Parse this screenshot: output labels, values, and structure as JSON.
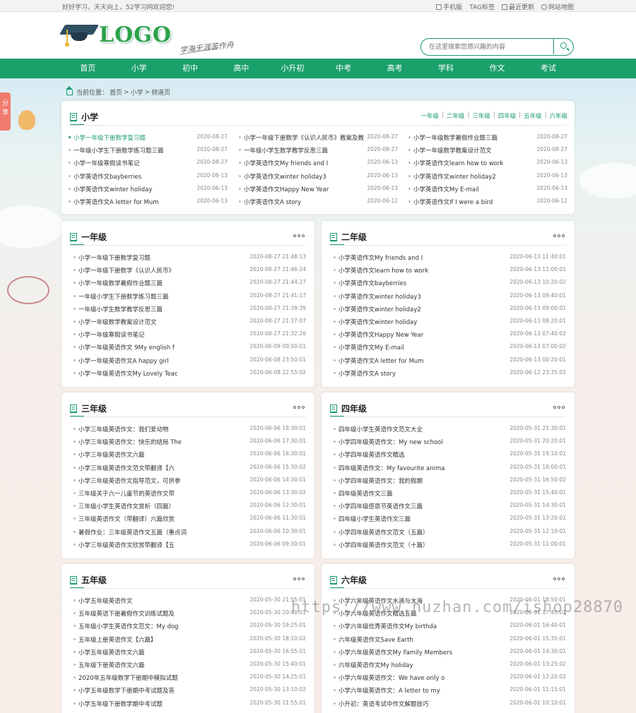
{
  "topbar": {
    "welcome": "好好学习，天天向上，52学习网欢迎您!",
    "links": [
      "手机版",
      "TAG标签",
      "最近更新",
      "网站地图"
    ]
  },
  "header": {
    "logo_text": "LOGO",
    "slogan": "学海无涯苦作舟",
    "search_placeholder": "在这里搜索您感兴趣的内容"
  },
  "nav": [
    "首页",
    "小学",
    "初中",
    "高中",
    "小升初",
    "中考",
    "高考",
    "学科",
    "作文",
    "考试"
  ],
  "breadcrumb": {
    "label": "当前位置：",
    "items": [
      "首页",
      ">",
      "小学",
      ">",
      "频道页"
    ]
  },
  "share": "分享",
  "top_panel": {
    "title": "小学",
    "grades": [
      "一年级",
      "二年级",
      "三年级",
      "四年级",
      "五年级",
      "六年级"
    ],
    "columns": [
      [
        {
          "t": "小学一年级下册数学复习题",
          "d": "2020-08-27"
        },
        {
          "t": "一年级小学生下册数学练习题三篇",
          "d": "2020-08-27"
        },
        {
          "t": "小学一年级寒假读书笔记",
          "d": "2020-08-27"
        },
        {
          "t": "小学英语作文bayberries",
          "d": "2020-06-13"
        },
        {
          "t": "小学英语作文winter holiday",
          "d": "2020-06-13"
        },
        {
          "t": "小学英语作文A letter for Mum",
          "d": "2020-06-13"
        }
      ],
      [
        {
          "t": "小学一年级下册数学《认识人民币》教案及教",
          "d": "2020-08-27"
        },
        {
          "t": "一年级小学生数学教学反思三篇",
          "d": "2020-08-27"
        },
        {
          "t": "小学英语作文My friends and I",
          "d": "2020-06-13"
        },
        {
          "t": "小学英语作文winter holiday3",
          "d": "2020-06-13"
        },
        {
          "t": "小学英语作文Happy New Year",
          "d": "2020-06-13"
        },
        {
          "t": "小学英语作文A story",
          "d": "2020-06-12"
        }
      ],
      [
        {
          "t": "小学一年级数学暑假作业题三篇",
          "d": "2020-08-27"
        },
        {
          "t": "小学一年级数学教案设计范文",
          "d": "2020-08-27"
        },
        {
          "t": "小学英语作文learn how to work",
          "d": "2020-06-13"
        },
        {
          "t": "小学英语作文winter holiday2",
          "d": "2020-06-13"
        },
        {
          "t": "小学英语作文My E-mail",
          "d": "2020-06-13"
        },
        {
          "t": "小学英语作文If I were a bird",
          "d": "2020-06-12"
        }
      ]
    ]
  },
  "panels": [
    {
      "title": "一年级",
      "items": [
        {
          "t": "小学一年级下册数学复习题",
          "d": "2020-08-27 21:48:13"
        },
        {
          "t": "小学一年级下册数学《认识人民币》",
          "d": "2020-08-27 21:46:24"
        },
        {
          "t": "小学一年级数学暑假作业题三篇",
          "d": "2020-08-27 21:44:27"
        },
        {
          "t": "一年级小学生下册数学练习题三篇",
          "d": "2020-08-27 21:41:17"
        },
        {
          "t": "一年级小学生数学教学反思三篇",
          "d": "2020-08-27 21:39:39"
        },
        {
          "t": "小学一年级数学教案设计范文",
          "d": "2020-08-27 21:37:07"
        },
        {
          "t": "小学一年级寒假读书笔记",
          "d": "2020-08-27 21:32:26"
        },
        {
          "t": "小学一年级英语作文 9My english f",
          "d": "2020-06-09 00:50:01"
        },
        {
          "t": "小学一年级英语作文A happy girl",
          "d": "2020-06-08 23:50:01"
        },
        {
          "t": "小学一年级英语作文My Lovely Teac",
          "d": "2020-06-08 22:55:02"
        }
      ]
    },
    {
      "title": "二年级",
      "items": [
        {
          "t": "小学英语作文My friends and I",
          "d": "2020-06-13 11:40:01"
        },
        {
          "t": "小学英语作文learn how to work",
          "d": "2020-06-13 11:00:01"
        },
        {
          "t": "小学英语作文bayberries",
          "d": "2020-06-13 10:20:02"
        },
        {
          "t": "小学英语作文winter holiday3",
          "d": "2020-06-13 09:40:01"
        },
        {
          "t": "小学英语作文winter holiday2",
          "d": "2020-06-13 09:00:01"
        },
        {
          "t": "小学英语作文winter holiday",
          "d": "2020-06-13 08:20:01"
        },
        {
          "t": "小学英语作文Happy New Year",
          "d": "2020-06-13 07:40:02"
        },
        {
          "t": "小学英语作文My E-mail",
          "d": "2020-06-13 07:00:02"
        },
        {
          "t": "小学英语作文A letter for Mum",
          "d": "2020-06-13 00:20:01"
        },
        {
          "t": "小学英语作文A story",
          "d": "2020-06-12 23:35:02"
        }
      ]
    },
    {
      "title": "三年级",
      "items": [
        {
          "t": "小学三年级英语作文：我们爱动物",
          "d": "2020-06-06 18:30:01"
        },
        {
          "t": "小学三年级英语作文：快乐的结局 The",
          "d": "2020-06-06 17:30:01"
        },
        {
          "t": "小学三年级英语作文六篇",
          "d": "2020-06-06 16:30:01"
        },
        {
          "t": "小学三年级英语作文范文带翻译【六",
          "d": "2020-06-06 15:30:02"
        },
        {
          "t": "小学三年级英语作文指导范文，可供参",
          "d": "2020-06-06 14:30:01"
        },
        {
          "t": "三年级关于六一儿童节的英语作文带",
          "d": "2020-06-06 13:30:02"
        },
        {
          "t": "三年级小学生英语作文赏析（四篇）",
          "d": "2020-06-06 12:30:01"
        },
        {
          "t": "三年级英语作文（带翻译）六篇欣赏",
          "d": "2020-06-06 11:30:01"
        },
        {
          "t": "暑假作业：三年级英语作文五篇（重点词",
          "d": "2020-06-06 10:30:01"
        },
        {
          "t": "小学三年级英语作文欣赏带翻译【五",
          "d": "2020-06-06 09:30:01"
        }
      ]
    },
    {
      "title": "四年级",
      "items": [
        {
          "t": "四年级小学生英语作文范文大全",
          "d": "2020-05-31 21:30:01"
        },
        {
          "t": "小学四年级英语作文：My new school",
          "d": "2020-05-31 20:20:01"
        },
        {
          "t": "小学四年级英语作文精选",
          "d": "2020-05-31 19:10:01"
        },
        {
          "t": "四年级英语作文：My favourite anima",
          "d": "2020-05-31 18:00:01"
        },
        {
          "t": "小学四年级英语作文：我的假期",
          "d": "2020-05-31 16:50:02"
        },
        {
          "t": "四年级英语作文三篇",
          "d": "2020-05-31 15:40:01"
        },
        {
          "t": "小学四年级感恩节英语作文三篇",
          "d": "2020-05-31 14:30:01"
        },
        {
          "t": "四年级小学生英语作文三篇",
          "d": "2020-05-31 13:20:01"
        },
        {
          "t": "小学四年级英语作文范文（五篇）",
          "d": "2020-05-31 12:10:01"
        },
        {
          "t": "小学四年级英语作文范文（十篇）",
          "d": "2020-05-31 11:00:01"
        }
      ]
    },
    {
      "title": "五年级",
      "items": [
        {
          "t": "小学五年级英语作文",
          "d": "2020-05-30 21:55:01"
        },
        {
          "t": "五年级英语下册暑假作文训练试题及",
          "d": "2020-05-30 20:40:01"
        },
        {
          "t": "五年级小学生英语作文范文：My dog",
          "d": "2020-05-30 19:25:01"
        },
        {
          "t": "五年级上册英语作文【六篇】",
          "d": "2020-05-30 18:10:02"
        },
        {
          "t": "小学五年级英语作文六篇",
          "d": "2020-05-30 16:55:01"
        },
        {
          "t": "五年级下册英语作文六篇",
          "d": "2020-05-30 15:40:01"
        },
        {
          "t": "2020年五年级数学下册期中模拟试题",
          "d": "2020-05-30 14:25:01"
        },
        {
          "t": "小学五年级数学下册期中考试题及答",
          "d": "2020-05-30 13:10:02"
        },
        {
          "t": "小学五年级下册数学期中考试题",
          "d": "2020-05-30 11:55:01"
        }
      ]
    },
    {
      "title": "六年级",
      "items": [
        {
          "t": "小学六年级英语作文水滴与大海",
          "d": "2020-06-01 18:50:01"
        },
        {
          "t": "小学六年级英语作文精选五篇",
          "d": "2020-06-01 17:45:01"
        },
        {
          "t": "小学六年级优秀英语作文My birthda",
          "d": "2020-06-01 16:40:01"
        },
        {
          "t": "六年级英语作文Save Earth",
          "d": "2020-06-01 15:35:01"
        },
        {
          "t": "小学六年级英语作文My Family Members",
          "d": "2020-06-01 14:30:01"
        },
        {
          "t": "六年级英语作文My holiday",
          "d": "2020-06-01 13:25:02"
        },
        {
          "t": "小学六年级英语作文：We have only o",
          "d": "2020-06-01 12:20:02"
        },
        {
          "t": "小学六年级英语作文：A letter to my",
          "d": "2020-06-01 11:15:01"
        },
        {
          "t": "小升初：英语考试中作文解题技巧",
          "d": "2020-06-01 10:10:01"
        }
      ]
    }
  ],
  "watermark": "https://www.huzhan.com/ishop28870"
}
